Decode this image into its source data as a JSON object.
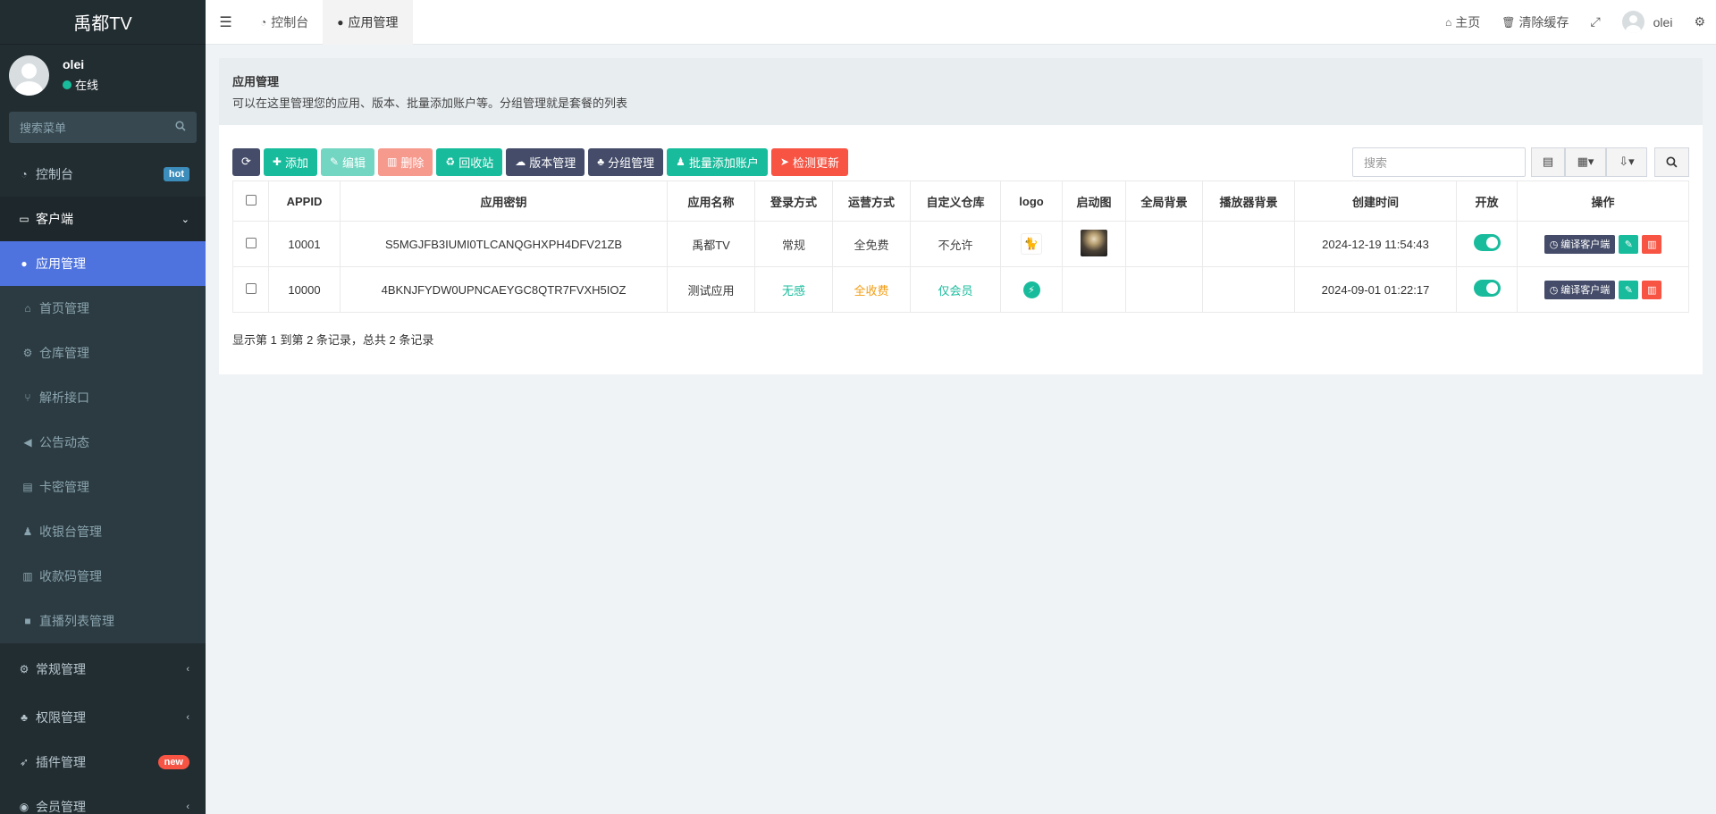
{
  "sidebar": {
    "brand": "禹都TV",
    "user": {
      "name": "olei",
      "status": "在线"
    },
    "search_placeholder": "搜索菜单",
    "items": [
      {
        "label": "控制台",
        "icon": "dashboard-icon",
        "badge": "hot"
      },
      {
        "label": "客户端",
        "icon": "inbox-icon",
        "chevron": "⌄"
      },
      {
        "label": "应用管理",
        "icon": "android-icon"
      },
      {
        "label": "首页管理",
        "icon": "home-icon"
      },
      {
        "label": "仓库管理",
        "icon": "cogs-icon"
      },
      {
        "label": "解析接口",
        "icon": "usb-icon"
      },
      {
        "label": "公告动态",
        "icon": "bullhorn-icon"
      },
      {
        "label": "卡密管理",
        "icon": "id-card-icon"
      },
      {
        "label": "收银台管理",
        "icon": "user-plus-icon"
      },
      {
        "label": "收款码管理",
        "icon": "barcode-icon"
      },
      {
        "label": "直播列表管理",
        "icon": "video-icon"
      },
      {
        "label": "常规管理",
        "icon": "cogs-icon",
        "chevron": "‹"
      },
      {
        "label": "权限管理",
        "icon": "group-icon",
        "chevron": "‹"
      },
      {
        "label": "插件管理",
        "icon": "rocket-icon",
        "badge": "new"
      },
      {
        "label": "会员管理",
        "icon": "user-circle-icon",
        "chevron": "‹"
      }
    ]
  },
  "topbar": {
    "tabs": [
      {
        "label": "控制台",
        "icon": "dashboard-icon"
      },
      {
        "label": "应用管理",
        "icon": "android-icon"
      }
    ],
    "home": "主页",
    "clear_cache": "清除缓存",
    "username": "olei"
  },
  "panel": {
    "title": "应用管理",
    "description": "可以在这里管理您的应用、版本、批量添加账户等。分组管理就是套餐的列表"
  },
  "toolbar": {
    "add": "添加",
    "edit": "编辑",
    "delete": "删除",
    "recycle": "回收站",
    "version": "版本管理",
    "group": "分组管理",
    "batch_add": "批量添加账户",
    "check_update": "检测更新",
    "search_placeholder": "搜索"
  },
  "table": {
    "headers": [
      "APPID",
      "应用密钥",
      "应用名称",
      "登录方式",
      "运营方式",
      "自定义仓库",
      "logo",
      "启动图",
      "全局背景",
      "播放器背景",
      "创建时间",
      "开放",
      "操作"
    ],
    "rows": [
      {
        "appid": "10001",
        "key": "S5MGJFB3IUMI0TLCANQGHXPH4DFV21ZB",
        "name": "禹都TV",
        "login": "常规",
        "operation": "全免费",
        "custom_repo": "不允许",
        "created": "2024-12-19 11:54:43",
        "open": true
      },
      {
        "appid": "10000",
        "key": "4BKNJFYDW0UPNCAEYGC8QTR7FVXH5IOZ",
        "name": "测试应用",
        "login": "无感",
        "operation": "全收费",
        "custom_repo": "仅会员",
        "created": "2024-09-01 01:22:17",
        "open": true
      }
    ],
    "compile_label": "编译客户端"
  },
  "pagination": "显示第 1 到第 2 条记录，总共 2 条记录",
  "colors": {
    "sidebar": "#222d32",
    "active": "#4e73df",
    "primary_dark": "#444c69",
    "success": "#18bc9c",
    "danger": "#f75444",
    "warning": "#f39c12"
  }
}
